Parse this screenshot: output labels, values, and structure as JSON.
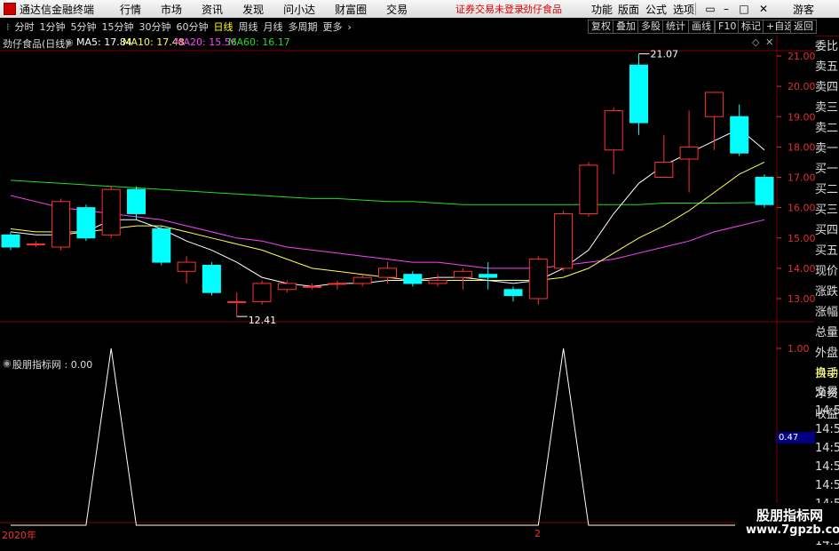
{
  "titlebar": {
    "app_name": "通达信金融终端",
    "menus": [
      "行情",
      "市场",
      "资讯",
      "发现",
      "问小达",
      "财富圈",
      "交易"
    ],
    "warning": "证券交易未登录",
    "stock_name": "劲仔食品",
    "right_menus": [
      "功能",
      "版面",
      "公式",
      "选项"
    ],
    "guest": "游客"
  },
  "toolbar": {
    "periods": [
      "分时",
      "1分钟",
      "5分钟",
      "15分钟",
      "30分钟",
      "60分钟",
      "日线",
      "周线",
      "月线",
      "多周期",
      "更多"
    ],
    "active_period": "日线",
    "right_tools": [
      "复权",
      "叠加",
      "多股",
      "统计",
      "画线",
      "F10",
      "标记",
      "+自选",
      "返回"
    ]
  },
  "main_pane": {
    "stock_title": "劲仔食品(日线)",
    "ma": [
      {
        "label": "MA5: 17.84",
        "color": "#ffffff"
      },
      {
        "label": "MA10: 17.48",
        "color": "#ffff55"
      },
      {
        "label": "MA20: 15.56",
        "color": "#ff44ff"
      },
      {
        "label": "MA60: 16.17",
        "color": "#22dd22"
      }
    ],
    "price_ticks": [
      "21.00",
      "20.00",
      "19.00",
      "18.00",
      "17.00",
      "16.00",
      "15.00",
      "14.00",
      "13.00"
    ],
    "high_label": "21.07",
    "low_label": "12.41"
  },
  "sub_pane": {
    "title": "股朋指标网 : 0.00",
    "ticks": [
      "1.00",
      "0.47"
    ],
    "cursor_value": "0.47"
  },
  "x_axis": {
    "start_label": "2020年",
    "mid_label": "2"
  },
  "right_panel": {
    "order_items": [
      "委比",
      "卖五",
      "卖四",
      "卖三",
      "卖二",
      "卖一",
      "买一",
      "买二",
      "买三",
      "买四",
      "买五",
      "现价",
      "涨跌",
      "涨幅",
      "总量",
      "外盘",
      "换手",
      "净资",
      "收益"
    ],
    "trade_items": [
      "自动",
      "交易",
      "14:56",
      "14:56",
      "14:56",
      "14:56",
      "14:56",
      "14:56",
      "14:56",
      "14:56"
    ]
  },
  "watermark": {
    "line1": "股朋指标网",
    "line2": "www.7gpzb.com"
  },
  "colors": {
    "up": "#ff3232",
    "down": "#00ffff",
    "grid": "#800000",
    "axis": "#e03030"
  },
  "chart_data": {
    "type": "candlestick",
    "price_range": [
      12.3,
      21.5
    ],
    "candles": [
      {
        "o": 15.1,
        "c": 14.7,
        "h": 15.2,
        "l": 14.6
      },
      {
        "o": 14.8,
        "c": 14.8,
        "h": 14.9,
        "l": 14.7
      },
      {
        "o": 14.7,
        "c": 16.2,
        "h": 16.3,
        "l": 14.6
      },
      {
        "o": 16.0,
        "c": 15.0,
        "h": 16.1,
        "l": 14.9
      },
      {
        "o": 15.1,
        "c": 16.6,
        "h": 16.7,
        "l": 15.0
      },
      {
        "o": 16.6,
        "c": 15.8,
        "h": 16.7,
        "l": 15.6
      },
      {
        "o": 15.3,
        "c": 14.2,
        "h": 15.4,
        "l": 14.1
      },
      {
        "o": 13.9,
        "c": 14.2,
        "h": 14.4,
        "l": 13.5
      },
      {
        "o": 14.1,
        "c": 13.2,
        "h": 14.2,
        "l": 13.1
      },
      {
        "o": 12.9,
        "c": 12.9,
        "h": 13.2,
        "l": 12.41
      },
      {
        "o": 12.9,
        "c": 13.5,
        "h": 13.6,
        "l": 12.8
      },
      {
        "o": 13.3,
        "c": 13.5,
        "h": 13.6,
        "l": 13.2
      },
      {
        "o": 13.4,
        "c": 13.4,
        "h": 13.5,
        "l": 13.3
      },
      {
        "o": 13.5,
        "c": 13.5,
        "h": 13.6,
        "l": 13.3
      },
      {
        "o": 13.5,
        "c": 13.7,
        "h": 13.8,
        "l": 13.4
      },
      {
        "o": 13.7,
        "c": 14.0,
        "h": 14.2,
        "l": 13.5
      },
      {
        "o": 13.8,
        "c": 13.5,
        "h": 13.9,
        "l": 13.4
      },
      {
        "o": 13.5,
        "c": 13.6,
        "h": 13.8,
        "l": 13.4
      },
      {
        "o": 13.7,
        "c": 13.9,
        "h": 14.0,
        "l": 13.3
      },
      {
        "o": 13.8,
        "c": 13.7,
        "h": 14.2,
        "l": 13.3
      },
      {
        "o": 13.3,
        "c": 13.1,
        "h": 13.4,
        "l": 12.9
      },
      {
        "o": 13.0,
        "c": 14.3,
        "h": 14.4,
        "l": 12.8
      },
      {
        "o": 14.0,
        "c": 15.8,
        "h": 15.9,
        "l": 13.9
      },
      {
        "o": 15.8,
        "c": 17.4,
        "h": 17.5,
        "l": 15.7
      },
      {
        "o": 17.9,
        "c": 19.2,
        "h": 19.3,
        "l": 17.1
      },
      {
        "o": 20.7,
        "c": 18.8,
        "h": 21.07,
        "l": 18.4
      },
      {
        "o": 17.0,
        "c": 17.5,
        "h": 18.4,
        "l": 17.0
      },
      {
        "o": 17.6,
        "c": 18.0,
        "h": 19.2,
        "l": 16.5
      },
      {
        "o": 19.0,
        "c": 19.8,
        "h": 19.8,
        "l": 17.9
      },
      {
        "o": 19.0,
        "c": 17.8,
        "h": 19.4,
        "l": 17.7
      },
      {
        "o": 17.0,
        "c": 16.1,
        "h": 17.1,
        "l": 16.0
      }
    ],
    "ma5": [
      15.2,
      15.1,
      15.1,
      15.2,
      15.6,
      15.6,
      15.3,
      14.9,
      14.6,
      14.2,
      13.7,
      13.5,
      13.4,
      13.5,
      13.5,
      13.6,
      13.6,
      13.7,
      13.7,
      13.6,
      13.5,
      13.6,
      14.0,
      14.6,
      15.8,
      16.8,
      17.4,
      17.8,
      18.2,
      18.6,
      17.9
    ],
    "ma10": [
      15.3,
      15.2,
      15.2,
      15.2,
      15.3,
      15.4,
      15.4,
      15.2,
      15.0,
      14.8,
      14.6,
      14.3,
      14.0,
      13.9,
      13.8,
      13.7,
      13.6,
      13.6,
      13.6,
      13.6,
      13.6,
      13.6,
      13.7,
      14.0,
      14.5,
      15.0,
      15.4,
      15.9,
      16.5,
      17.1,
      17.5
    ],
    "ma20": [
      16.4,
      16.2,
      16.0,
      15.9,
      15.8,
      15.7,
      15.6,
      15.4,
      15.2,
      15.0,
      14.9,
      14.7,
      14.6,
      14.5,
      14.4,
      14.3,
      14.2,
      14.2,
      14.1,
      14.0,
      14.0,
      14.0,
      14.1,
      14.2,
      14.3,
      14.5,
      14.7,
      14.9,
      15.2,
      15.4,
      15.6
    ],
    "ma60": [
      16.9,
      16.85,
      16.8,
      16.75,
      16.7,
      16.65,
      16.6,
      16.55,
      16.5,
      16.45,
      16.4,
      16.35,
      16.3,
      16.3,
      16.25,
      16.2,
      16.2,
      16.15,
      16.1,
      16.1,
      16.1,
      16.1,
      16.1,
      16.1,
      16.1,
      16.1,
      16.15,
      16.15,
      16.15,
      16.16,
      16.17
    ],
    "indicator": {
      "name": "股朋指标网",
      "range": [
        0,
        1
      ],
      "values": [
        0,
        0,
        0,
        0,
        1,
        0,
        0,
        0,
        0,
        0,
        0,
        0,
        0,
        0,
        0,
        0,
        0,
        0,
        0,
        0,
        0,
        0,
        1,
        0,
        0,
        0,
        0,
        0,
        0,
        0,
        0
      ]
    }
  }
}
